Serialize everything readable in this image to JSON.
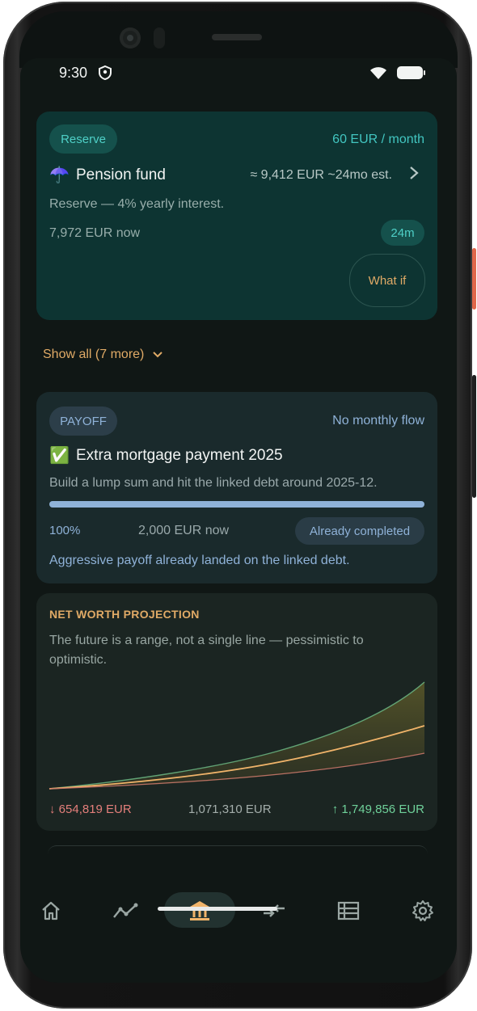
{
  "status": {
    "time": "9:30"
  },
  "reserve_card": {
    "badge": "Reserve",
    "monthly": "60 EUR / month",
    "icon": "umbrella-icon",
    "emoji": "☂️",
    "title": "Pension fund",
    "estimate": "≈ 9,412 EUR ~24mo est.",
    "description": "Reserve — 4% yearly interest.",
    "current": "7,972 EUR now",
    "term": "24m",
    "what_if": "What if"
  },
  "show_all": "Show all (7 more)",
  "payoff_card": {
    "badge": "PAYOFF",
    "flow": "No monthly flow",
    "emoji": "✅",
    "title": "Extra mortgage payment 2025",
    "description": "Build a lump sum and hit the linked debt around 2025-12.",
    "progress": 1.0,
    "percent": "100%",
    "current": "2,000 EUR now",
    "status": "Already completed",
    "note": "Aggressive payoff already landed on the linked debt."
  },
  "net_worth": {
    "heading": "NET WORTH PROJECTION",
    "description_line1": "The future is a range, not a single line — pessimistic to",
    "description_line2": "optimistic.",
    "low": "↓ 654,819 EUR",
    "mid": "1,071,310 EUR",
    "high": "↑ 1,749,856 EUR",
    "colors": {
      "low": "#e47f7b",
      "mid": "#f1b46a",
      "high": "#6fd19a"
    }
  },
  "nav": {
    "items": [
      {
        "name": "home-icon"
      },
      {
        "name": "trend-icon"
      },
      {
        "name": "bank-icon",
        "active": true
      },
      {
        "name": "transfer-icon"
      },
      {
        "name": "list-icon"
      },
      {
        "name": "settings-icon"
      }
    ]
  }
}
